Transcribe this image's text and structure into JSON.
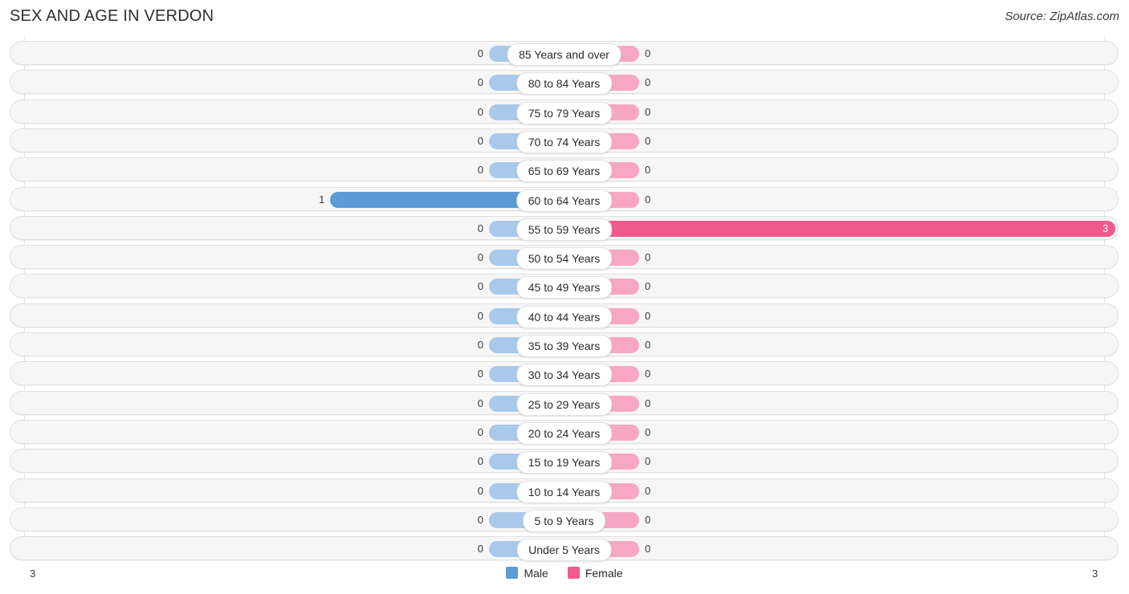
{
  "header": {
    "title": "SEX AND AGE IN VERDON",
    "source": "Source: ZipAtlas.com"
  },
  "legend": {
    "items": [
      {
        "label": "Male",
        "color": "#5b9bd5"
      },
      {
        "label": "Female",
        "color": "#ef5b8c"
      }
    ]
  },
  "axis": {
    "left_tick": "3",
    "right_tick": "3"
  },
  "chart_data": {
    "type": "bar",
    "title": "SEX AND AGE IN VERDON",
    "subtitle": "Source: ZipAtlas.com",
    "orientation": "horizontal",
    "layout": "population-pyramid",
    "xlabel": "",
    "ylabel": "",
    "xlim": [
      0,
      3
    ],
    "grid": true,
    "legend_position": "bottom-center",
    "categories": [
      "85 Years and over",
      "80 to 84 Years",
      "75 to 79 Years",
      "70 to 74 Years",
      "65 to 69 Years",
      "60 to 64 Years",
      "55 to 59 Years",
      "50 to 54 Years",
      "45 to 49 Years",
      "40 to 44 Years",
      "35 to 39 Years",
      "30 to 34 Years",
      "25 to 29 Years",
      "20 to 24 Years",
      "15 to 19 Years",
      "10 to 14 Years",
      "5 to 9 Years",
      "Under 5 Years"
    ],
    "series": [
      {
        "name": "Male",
        "color": "#5b9bd5",
        "values": [
          0,
          0,
          0,
          0,
          0,
          1,
          0,
          0,
          0,
          0,
          0,
          0,
          0,
          0,
          0,
          0,
          0,
          0
        ]
      },
      {
        "name": "Female",
        "color": "#ef5b8c",
        "values": [
          0,
          0,
          0,
          0,
          0,
          0,
          3,
          0,
          0,
          0,
          0,
          0,
          0,
          0,
          0,
          0,
          0,
          0
        ]
      }
    ]
  }
}
